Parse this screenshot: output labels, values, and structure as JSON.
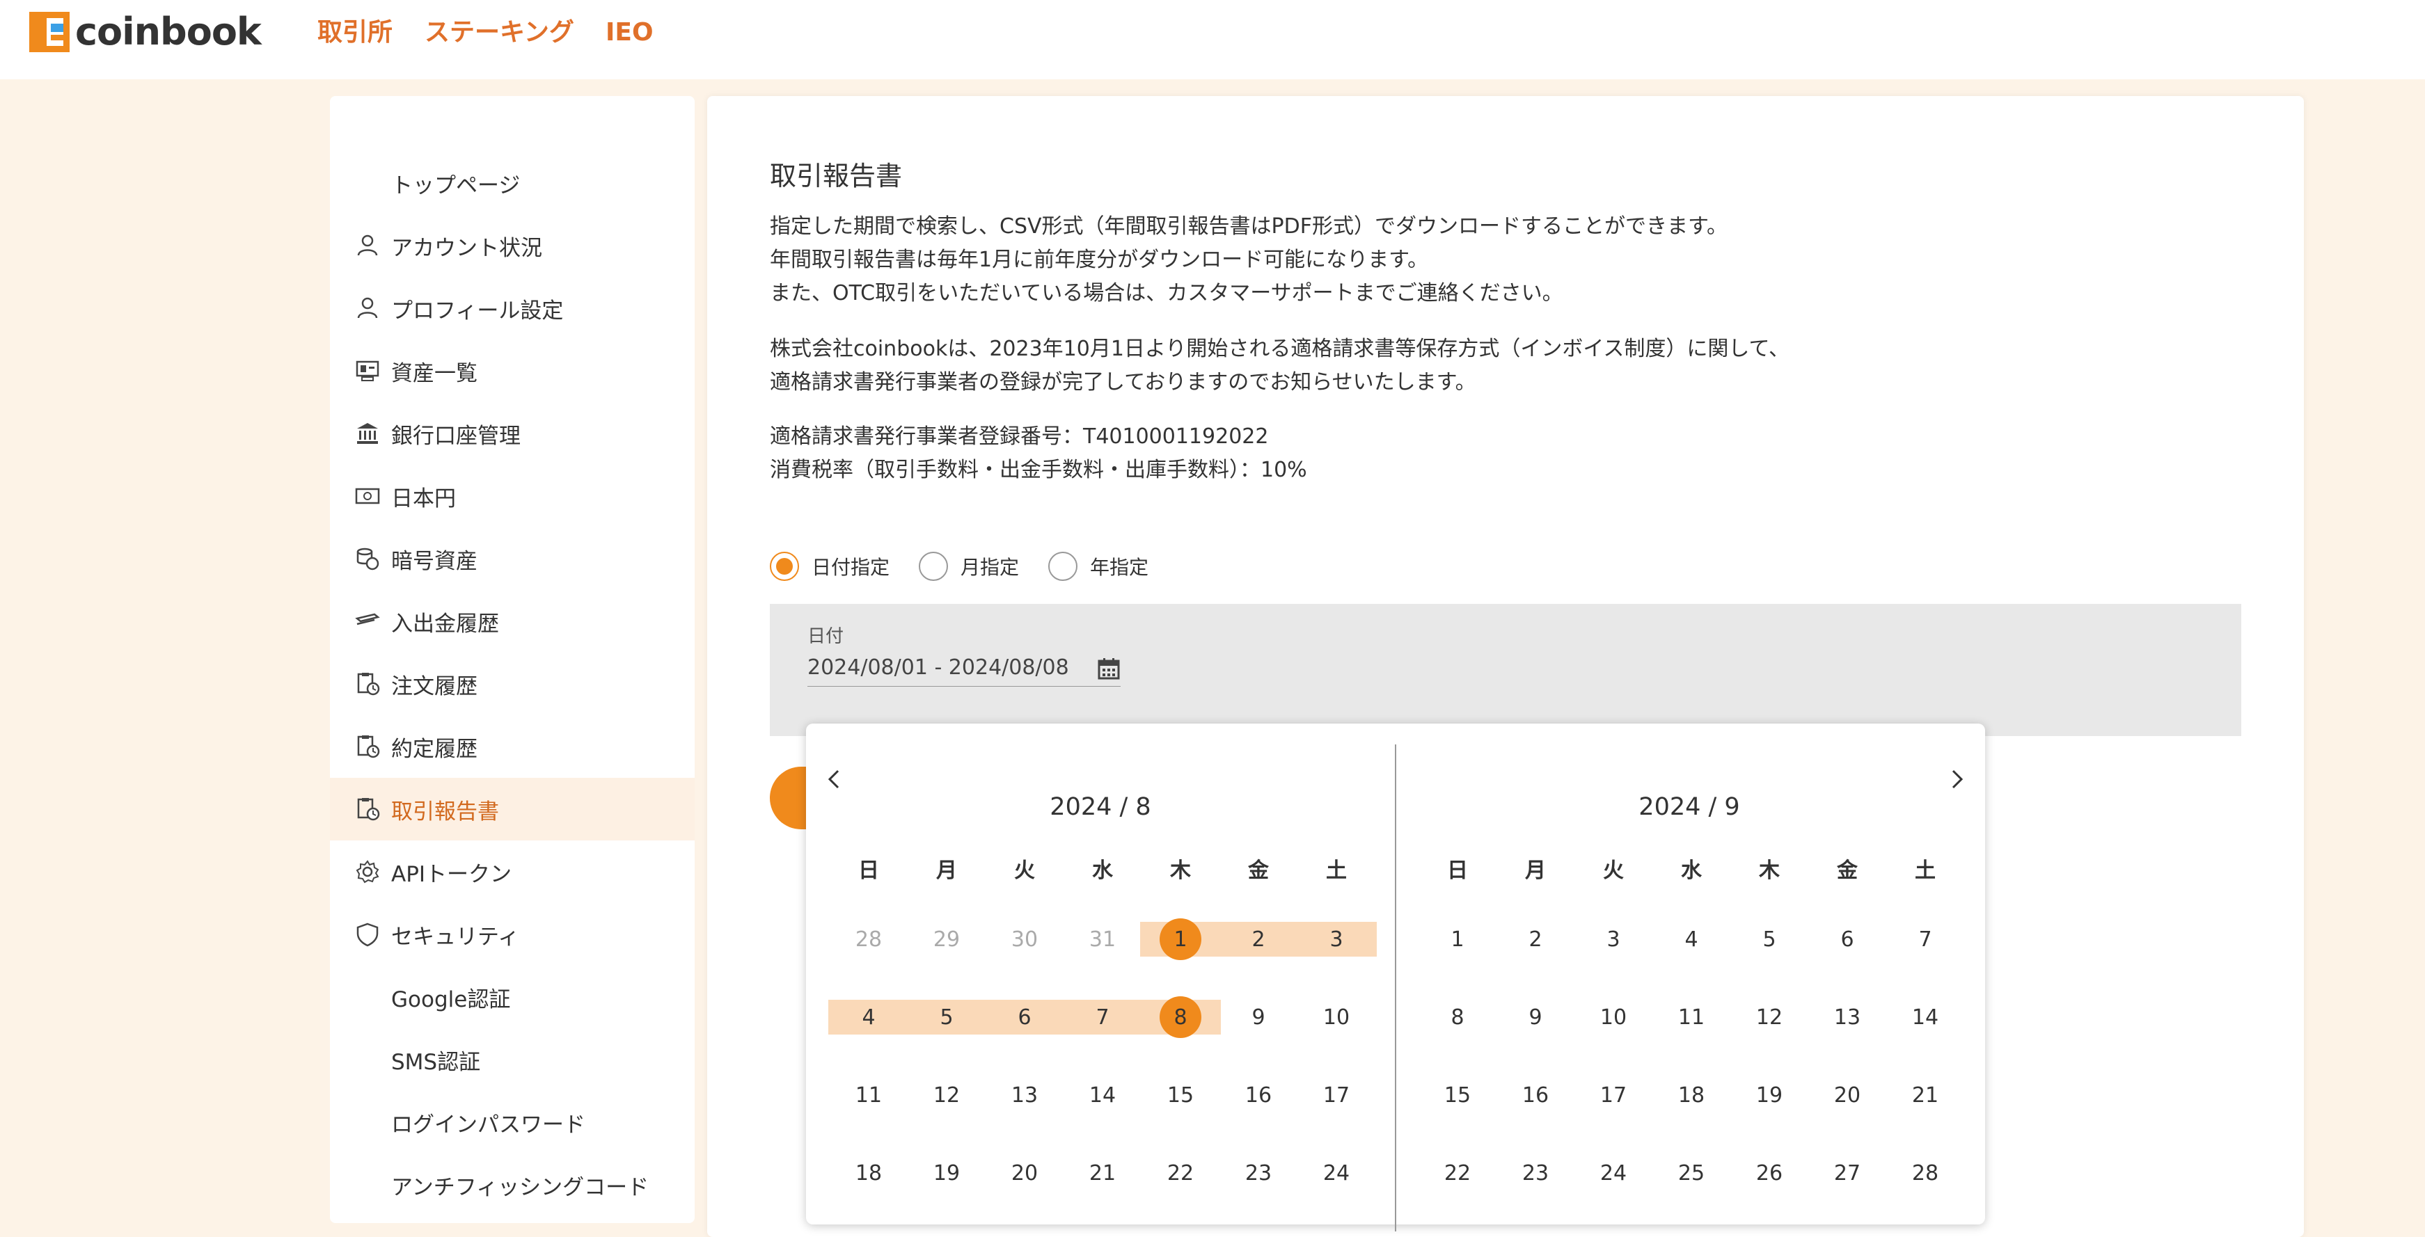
{
  "brand": {
    "name": "coinbook",
    "accent": "#f08a1c"
  },
  "nav": [
    {
      "label": "取引所"
    },
    {
      "label": "ステーキング"
    },
    {
      "label": "IEO"
    }
  ],
  "sidebar": {
    "items": [
      {
        "label": "トップページ",
        "icon": "none"
      },
      {
        "label": "アカウント状況",
        "icon": "user-icon"
      },
      {
        "label": "プロフィール設定",
        "icon": "user-icon"
      },
      {
        "label": "資産一覧",
        "icon": "assets-icon"
      },
      {
        "label": "銀行口座管理",
        "icon": "bank-icon"
      },
      {
        "label": "日本円",
        "icon": "yen-bill-icon"
      },
      {
        "label": "暗号資産",
        "icon": "coins-icon"
      },
      {
        "label": "入出金履歴",
        "icon": "transfer-icon"
      },
      {
        "label": "注文履歴",
        "icon": "history-icon"
      },
      {
        "label": "約定履歴",
        "icon": "history-icon"
      },
      {
        "label": "取引報告書",
        "icon": "history-icon",
        "active": true
      },
      {
        "label": "APIトークン",
        "icon": "gear-icon"
      },
      {
        "label": "セキュリティ",
        "icon": "shield-icon"
      },
      {
        "label": "Google認証",
        "icon": "none"
      },
      {
        "label": "SMS認証",
        "icon": "none"
      },
      {
        "label": "ログインパスワード",
        "icon": "none"
      },
      {
        "label": "アンチフィッシングコード",
        "icon": "none"
      }
    ]
  },
  "main": {
    "title": "取引報告書",
    "desc": [
      "指定した期間で検索し、CSV形式（年間取引報告書はPDF形式）でダウンロードすることができます。",
      "年間取引報告書は毎年1月に前年度分がダウンロード可能になります。",
      "また、OTC取引をいただいている場合は、カスタマーサポートまでご連絡ください。"
    ],
    "invoice": [
      "株式会社coinbookは、2023年10月1日より開始される適格請求書等保存方式（インボイス制度）に関して、",
      "適格請求書発行事業者の登録が完了しておりますのでお知らせいたします。"
    ],
    "registration": [
      "適格請求書発行事業者登録番号：T4010001192022",
      "消費税率（取引手数料・出金手数料・出庫手数料）：10%"
    ],
    "radios": [
      {
        "label": "日付指定",
        "checked": true
      },
      {
        "label": "月指定",
        "checked": false
      },
      {
        "label": "年指定",
        "checked": false
      }
    ],
    "date_label": "日付",
    "date_value": "2024/08/01 - 2024/08/08"
  },
  "calendar": {
    "weekdays": [
      "日",
      "月",
      "火",
      "水",
      "木",
      "金",
      "土"
    ],
    "months": [
      {
        "title": "2024 / 8",
        "weeks": [
          [
            28,
            29,
            30,
            31,
            1,
            2,
            3
          ],
          [
            4,
            5,
            6,
            7,
            8,
            9,
            10
          ],
          [
            11,
            12,
            13,
            14,
            15,
            16,
            17
          ],
          [
            18,
            19,
            20,
            21,
            22,
            23,
            24
          ]
        ],
        "muted_first_week_count": 4
      },
      {
        "title": "2024 / 9",
        "weeks": [
          [
            1,
            2,
            3,
            4,
            5,
            6,
            7
          ],
          [
            8,
            9,
            10,
            11,
            12,
            13,
            14
          ],
          [
            15,
            16,
            17,
            18,
            19,
            20,
            21
          ],
          [
            22,
            23,
            24,
            25,
            26,
            27,
            28
          ]
        ],
        "muted_first_week_count": 0
      }
    ],
    "range_start": 1,
    "range_end": 8
  }
}
